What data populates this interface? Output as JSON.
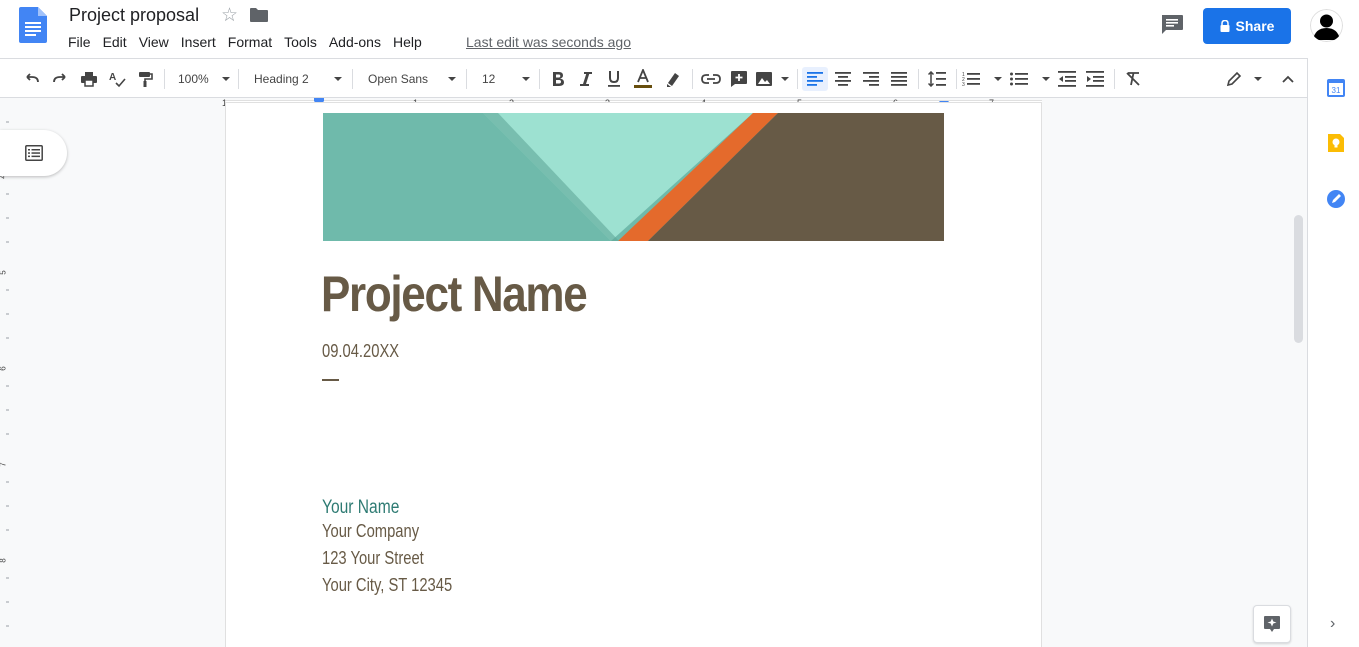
{
  "header": {
    "title": "Project proposal",
    "menus": [
      "File",
      "Edit",
      "View",
      "Insert",
      "Format",
      "Tools",
      "Add-ons",
      "Help"
    ],
    "last_edit": "Last edit was seconds ago",
    "share_label": "Share"
  },
  "toolbar": {
    "zoom": "100%",
    "style": "Heading 2",
    "font": "Open Sans",
    "font_size": "12"
  },
  "ruler": {
    "numbers": [
      "1",
      "1",
      "2",
      "3",
      "4",
      "5",
      "6",
      "7"
    ],
    "vertical_numbers": [
      "4",
      "5",
      "6",
      "7",
      "8"
    ]
  },
  "document": {
    "project_name": "Project Name",
    "date": "09.04.20XX",
    "your_name": "Your Name",
    "company": "Your Company",
    "street": "123 Your Street",
    "city": "Your City, ST 12345"
  },
  "side_panel": {
    "calendar_day": "31"
  },
  "colors": {
    "accent": "#1a73e8",
    "heading": "#675a46",
    "name": "#2e7b73",
    "banner_teal": "#6fbaab",
    "banner_mint": "#9de1d1",
    "banner_orange": "#e46a2c",
    "banner_brown": "#675a46"
  }
}
